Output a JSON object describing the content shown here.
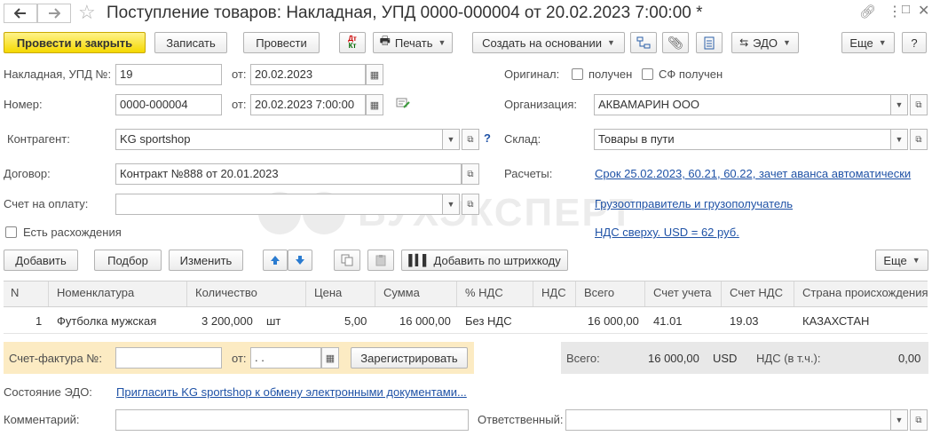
{
  "window": {
    "title": "Поступление товаров: Накладная, УПД 0000-000004 от 20.02.2023 7:00:00 *"
  },
  "toolbar": {
    "post_close": "Провести и закрыть",
    "save": "Записать",
    "post": "Провести",
    "dtkt": "Дт Кт",
    "print": "Печать",
    "create_based": "Создать на основании",
    "edo": "ЭДО",
    "more": "Еще",
    "help": "?"
  },
  "form": {
    "invoice_label": "Накладная, УПД №:",
    "invoice_value": "19",
    "from_label": "от:",
    "invoice_date": "20.02.2023",
    "number_label": "Номер:",
    "number_value": "0000-000004",
    "number_date": "20.02.2023  7:00:00",
    "counterparty_label": "Контрагент:",
    "counterparty_value": "KG sportshop",
    "contract_label": "Договор:",
    "contract_value": "Контракт №888 от 20.01.2023",
    "payment_label": "Счет на оплату:",
    "payment_value": "",
    "discrepancy_label": "Есть расхождения",
    "original_label": "Оригинал:",
    "received_label": "получен",
    "sf_received_label": "СФ получен",
    "org_label": "Организация:",
    "org_value": "АКВАМАРИН ООО",
    "warehouse_label": "Склад:",
    "warehouse_value": "Товары в пути",
    "settlements_label": "Расчеты:",
    "settlements_link": "Срок 25.02.2023, 60.21, 60.22, зачет аванса автоматически",
    "shipper_link": "Грузоотправитель и грузополучатель",
    "vat_link": "НДС сверху. USD = 62 руб."
  },
  "table_toolbar": {
    "add": "Добавить",
    "pick": "Подбор",
    "change": "Изменить",
    "barcode": "Добавить по штрихкоду",
    "more": "Еще"
  },
  "table": {
    "headers": [
      "N",
      "Номенклатура",
      "Количество",
      "Цена",
      "Сумма",
      "% НДС",
      "НДС",
      "Всего",
      "Счет учета",
      "Счет НДС",
      "Страна происхождения"
    ],
    "rows": [
      {
        "n": "1",
        "item": "Футболка мужская",
        "qty": "3 200,000",
        "unit": "шт",
        "price": "5,00",
        "sum": "16 000,00",
        "vat_rate": "Без НДС",
        "vat": "",
        "total": "16 000,00",
        "account": "41.01",
        "vat_account": "19.03",
        "country": "КАЗАХСТАН"
      }
    ]
  },
  "invoice_block": {
    "label": "Счет-фактура №:",
    "number": "",
    "from_label": "от:",
    "date": " .  .",
    "register": "Зарегистрировать"
  },
  "totals": {
    "total_label": "Всего:",
    "total_value": "16 000,00",
    "currency": "USD",
    "vat_label": "НДС (в т.ч.):",
    "vat_value": "0,00"
  },
  "footer": {
    "edo_label": "Состояние ЭДО:",
    "edo_link": "Пригласить KG sportshop к обмену электронными документами...",
    "comment_label": "Комментарий:",
    "comment_value": "",
    "responsible_label": "Ответственный:",
    "responsible_value": ""
  },
  "watermark": "БУХЭКСПЕРТ",
  "colors": {
    "primary_button": "#f5d800",
    "link": "#1f52a6",
    "invoice_bg": "#fcebc3",
    "totals_bg": "#e8e8e8"
  }
}
